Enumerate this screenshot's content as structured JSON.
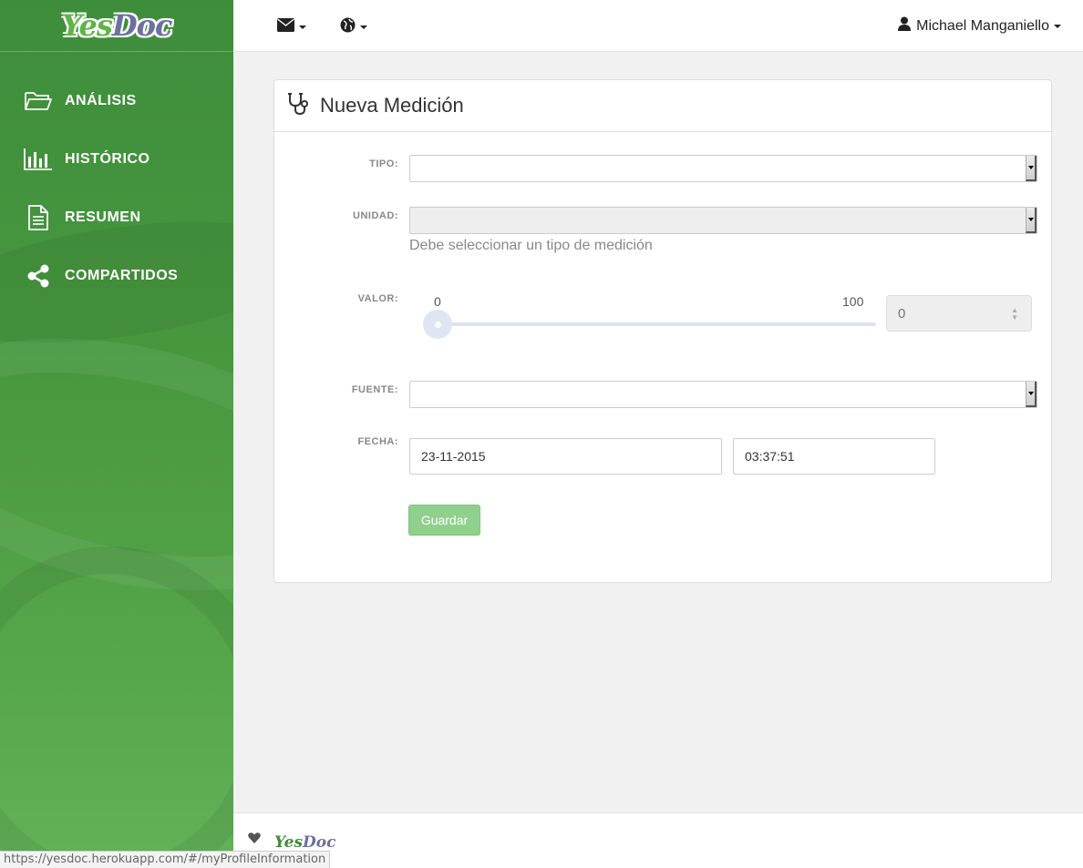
{
  "app": {
    "logo_yes": "Yes",
    "logo_doc": "Doc"
  },
  "sidebar": {
    "items": [
      {
        "label": "ANÁLISIS",
        "icon": "folder-open-icon"
      },
      {
        "label": "HISTÓRICO",
        "icon": "bar-chart-icon"
      },
      {
        "label": "RESUMEN",
        "icon": "document-icon"
      },
      {
        "label": "COMPARTIDOS",
        "icon": "share-icon"
      }
    ]
  },
  "topbar": {
    "messages_icon": "envelope-icon",
    "language_icon": "globe-icon",
    "user_name": "Michael Manganiello"
  },
  "panel": {
    "title": "Nueva Medición",
    "title_icon": "stethoscope-icon",
    "fields": {
      "tipo_label": "TIPO:",
      "tipo_value": "",
      "unidad_label": "UNIDAD:",
      "unidad_value": "",
      "unidad_help": "Debe seleccionar un tipo de medición",
      "valor_label": "VALOR:",
      "slider_min": "0",
      "slider_max": "100",
      "slider_value": 0,
      "valor_value": "0",
      "fuente_label": "FUENTE:",
      "fuente_value": "",
      "fecha_label": "FECHA:",
      "fecha_date": "23-11-2015",
      "fecha_time": "03:37:51"
    },
    "save_label": "Guardar"
  },
  "footer": {
    "logo_yes": "Yes",
    "logo_doc": "Doc"
  },
  "status_bar": {
    "url": "https://yesdoc.herokuapp.com/#/myProfileInformation"
  },
  "colors": {
    "sidebar_green": "#48973f",
    "save_button": "#8fd08d",
    "brand_purple": "#6e6f9f"
  }
}
